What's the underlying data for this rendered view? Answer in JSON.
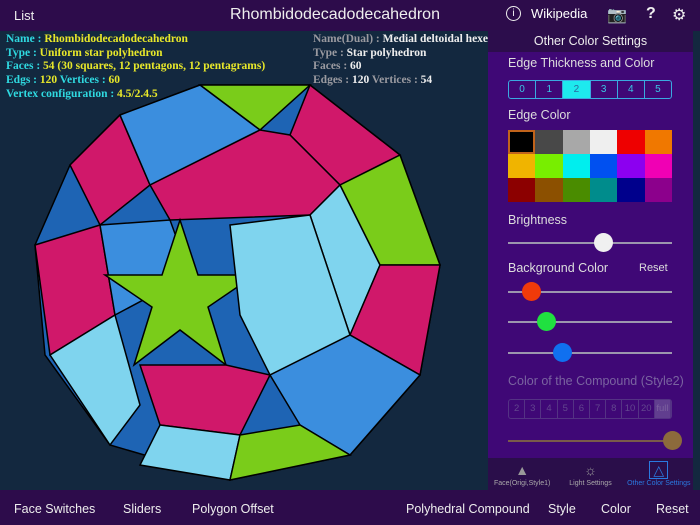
{
  "topbar": {
    "list": "List",
    "title": "Rhombidodecadodecahedron",
    "wikipedia": "Wikipedia"
  },
  "info": {
    "name_k": "Name : ",
    "name_v": "Rhombidodecadodecahedron",
    "type_k": "Type : ",
    "type_v": "Uniform star polyhedron",
    "faces_k": "Faces : ",
    "faces_v": "54 (30 squares, 12 pentagons, 12 pentagrams)",
    "edges_k": "Edgs : ",
    "edges_v": "120",
    "vert_k": " Vertices : ",
    "vert_v": "60",
    "vc_k": "Vertex configuration : ",
    "vc_v": "4.5/2.4.5"
  },
  "dual": {
    "name_k": "Name(Dual) : ",
    "name_v": "Medial deltoidal hexecontahedron",
    "type_k": "Type : ",
    "type_v": "Star polyhedron",
    "faces_k": "Faces : ",
    "faces_v": "60",
    "edges_k": "Edges : ",
    "edges_v": "120",
    "vert_k": " Vertices : ",
    "vert_v": "54"
  },
  "panel": {
    "title": "Other Color Settings",
    "edge_thickness": "Edge Thickness and Color",
    "thickness": [
      "0",
      "1",
      "2",
      "3",
      "4",
      "5"
    ],
    "thickness_selected": 2,
    "edge_color": "Edge Color",
    "colors": [
      "#000000",
      "#484848",
      "#a8a8a8",
      "#efefef",
      "#ee0000",
      "#f07800",
      "#f0b400",
      "#78ee00",
      "#00eeee",
      "#0050f0",
      "#8c00f0",
      "#f000b4",
      "#8c0000",
      "#8c5000",
      "#4a8c00",
      "#008c8c",
      "#00008c",
      "#8c008c"
    ],
    "brightness": "Brightness",
    "brightness_value": 0.58,
    "background_color": "Background Color",
    "reset": "Reset",
    "bg_rgb": [
      0.14,
      0.23,
      0.33
    ],
    "compound_color": "Color of the Compound (Style2)",
    "compound": [
      "2",
      "3",
      "4",
      "5",
      "6",
      "7",
      "8",
      "10",
      "20",
      "full"
    ],
    "compound_value": 1.0,
    "tabs": [
      "Face(Origi,Style1)",
      "Light Settings",
      "Other Color Settings"
    ]
  },
  "bottom": [
    "Face Switches",
    "Sliders",
    "Polygon Offset",
    "Polyhedral Compound",
    "Style",
    "Color",
    "Reset"
  ]
}
